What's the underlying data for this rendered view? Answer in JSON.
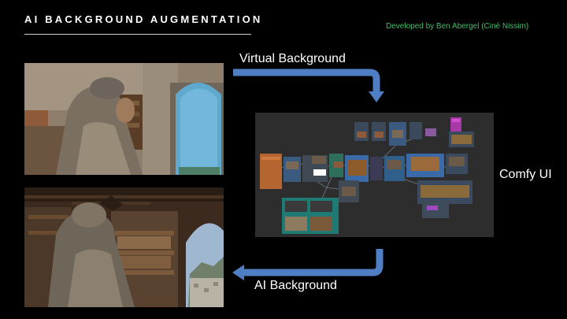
{
  "header": {
    "title": "AI BACKGROUND AUGMENTATION",
    "credit": "Developed by Ben Abergel (Ciné Nissim)"
  },
  "labels": {
    "virtual_background": "Virtual Background",
    "ai_background": "AI Background",
    "comfy_ui": "Comfy UI"
  },
  "colors": {
    "arrow": "#4f7ec4",
    "credit": "#3fbf6a",
    "background": "#000000"
  }
}
